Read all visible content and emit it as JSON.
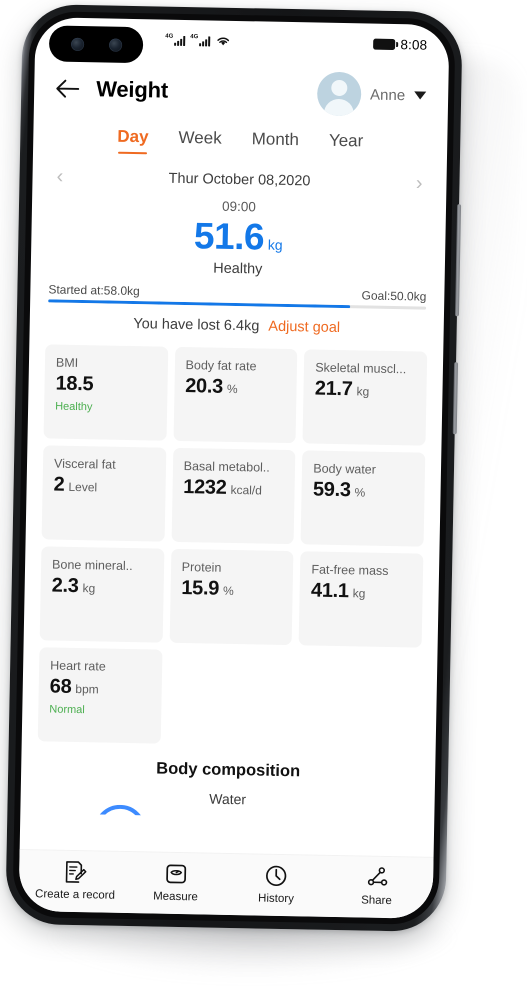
{
  "status_bar": {
    "network_label_1": "4G",
    "network_label_2": "4G",
    "wifi_icon": "wifi-icon",
    "battery_icon": "battery-icon",
    "time": "8:08"
  },
  "app_bar": {
    "back_icon": "back-arrow-icon",
    "title": "Weight",
    "user_name": "Anne",
    "caret_icon": "chevron-down-icon",
    "avatar_icon": "avatar-person-icon"
  },
  "tabs": [
    {
      "label": "Day",
      "active": true
    },
    {
      "label": "Week",
      "active": false
    },
    {
      "label": "Month",
      "active": false
    },
    {
      "label": "Year",
      "active": false
    }
  ],
  "date_nav": {
    "prev_icon": "chevron-left-icon",
    "next_icon": "chevron-right-icon",
    "date": "Thur October 08,2020"
  },
  "reading": {
    "time": "09:00",
    "value": "51.6",
    "unit": "kg",
    "status": "Healthy",
    "value_color": "#1378e8"
  },
  "progress": {
    "start_label": "Started at:58.0kg",
    "goal_label": "Goal:50.0kg",
    "percent": 80,
    "fill_color": "#1378e8",
    "track_color": "#e2e2e2",
    "lost_text": "You have lost 6.4kg",
    "adjust_label": "Adjust goal",
    "adjust_color": "#ef6a21"
  },
  "metrics": [
    {
      "label": "BMI",
      "value": "18.5",
      "unit": "",
      "status": "Healthy"
    },
    {
      "label": "Body fat rate",
      "value": "20.3",
      "unit": "%",
      "status": ""
    },
    {
      "label": "Skeletal muscl...",
      "value": "21.7",
      "unit": "kg",
      "status": ""
    },
    {
      "label": "Visceral fat",
      "value": "2",
      "unit": "Level",
      "status": ""
    },
    {
      "label": "Basal metabol..",
      "value": "1232",
      "unit": "kcal/d",
      "status": ""
    },
    {
      "label": "Body water",
      "value": "59.3",
      "unit": "%",
      "status": ""
    },
    {
      "label": "Bone mineral..",
      "value": "2.3",
      "unit": "kg",
      "status": ""
    },
    {
      "label": "Protein",
      "value": "15.9",
      "unit": "%",
      "status": ""
    },
    {
      "label": "Fat-free mass",
      "value": "41.1",
      "unit": "kg",
      "status": ""
    },
    {
      "label": "Heart rate",
      "value": "68",
      "unit": "bpm",
      "status": "Normal"
    }
  ],
  "composition": {
    "title": "Body composition",
    "subtitle": "Water"
  },
  "bottom_nav": [
    {
      "label": "Create a record",
      "icon": "record-note-icon"
    },
    {
      "label": "Measure",
      "icon": "scale-icon"
    },
    {
      "label": "History",
      "icon": "clock-icon"
    },
    {
      "label": "Share",
      "icon": "share-nodes-icon"
    }
  ]
}
